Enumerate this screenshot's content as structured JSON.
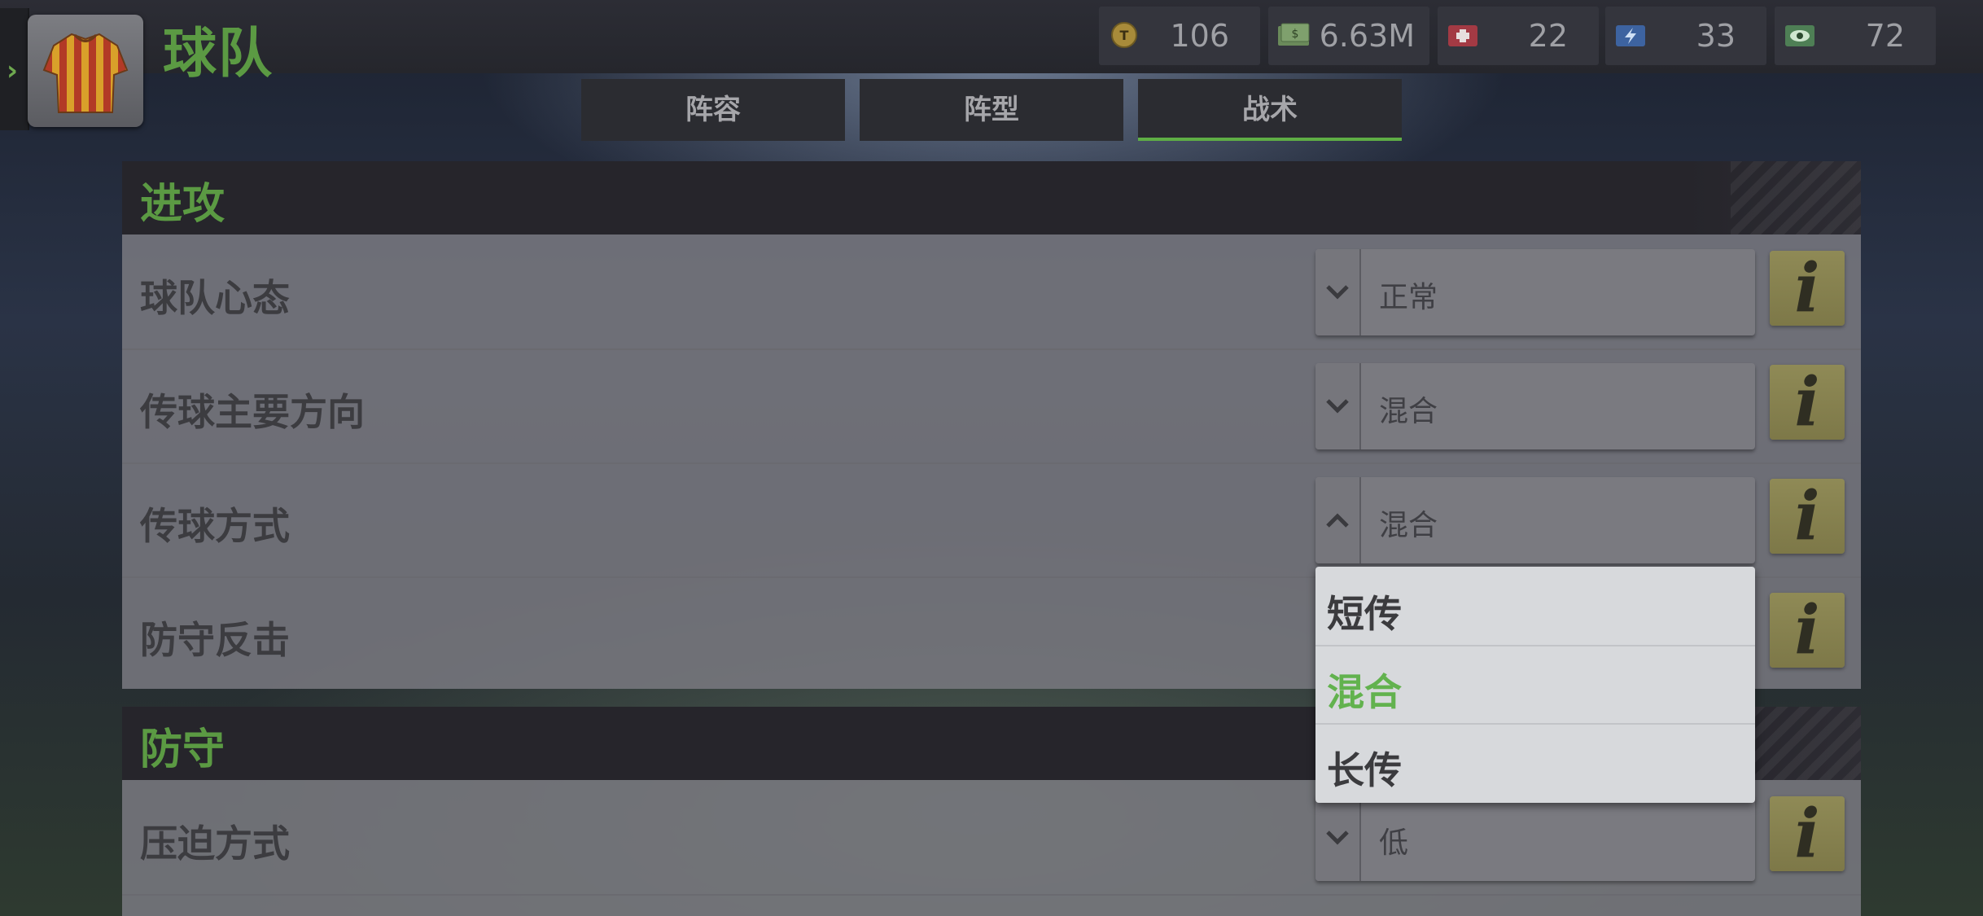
{
  "header": {
    "title": "球队",
    "resources": [
      {
        "icon": "token-coin-icon",
        "value": "106"
      },
      {
        "icon": "cash-icon",
        "value": "6.63M"
      },
      {
        "icon": "medical-kit-icon",
        "value": "22"
      },
      {
        "icon": "energy-icon",
        "value": "33"
      },
      {
        "icon": "scout-eye-icon",
        "value": "72"
      }
    ]
  },
  "tabs": [
    {
      "label": "阵容",
      "active": false
    },
    {
      "label": "阵型",
      "active": false
    },
    {
      "label": "战术",
      "active": true
    }
  ],
  "sections": [
    {
      "title": "进攻",
      "rows": [
        {
          "label": "球队心态",
          "value": "正常",
          "open": false
        },
        {
          "label": "传球主要方向",
          "value": "混合",
          "open": false
        },
        {
          "label": "传球方式",
          "value": "混合",
          "open": true
        },
        {
          "label": "防守反击",
          "value": "",
          "open": false
        }
      ]
    },
    {
      "title": "防守",
      "rows": [
        {
          "label": "压迫方式",
          "value": "低",
          "open": false
        }
      ]
    }
  ],
  "dropdown_menu": {
    "options": [
      "短传",
      "混合",
      "长传"
    ],
    "selected": "混合"
  },
  "colors": {
    "accent_green": "#5b9a43",
    "selected_green": "#62b24e",
    "info_yellow": "#8f8a56"
  }
}
